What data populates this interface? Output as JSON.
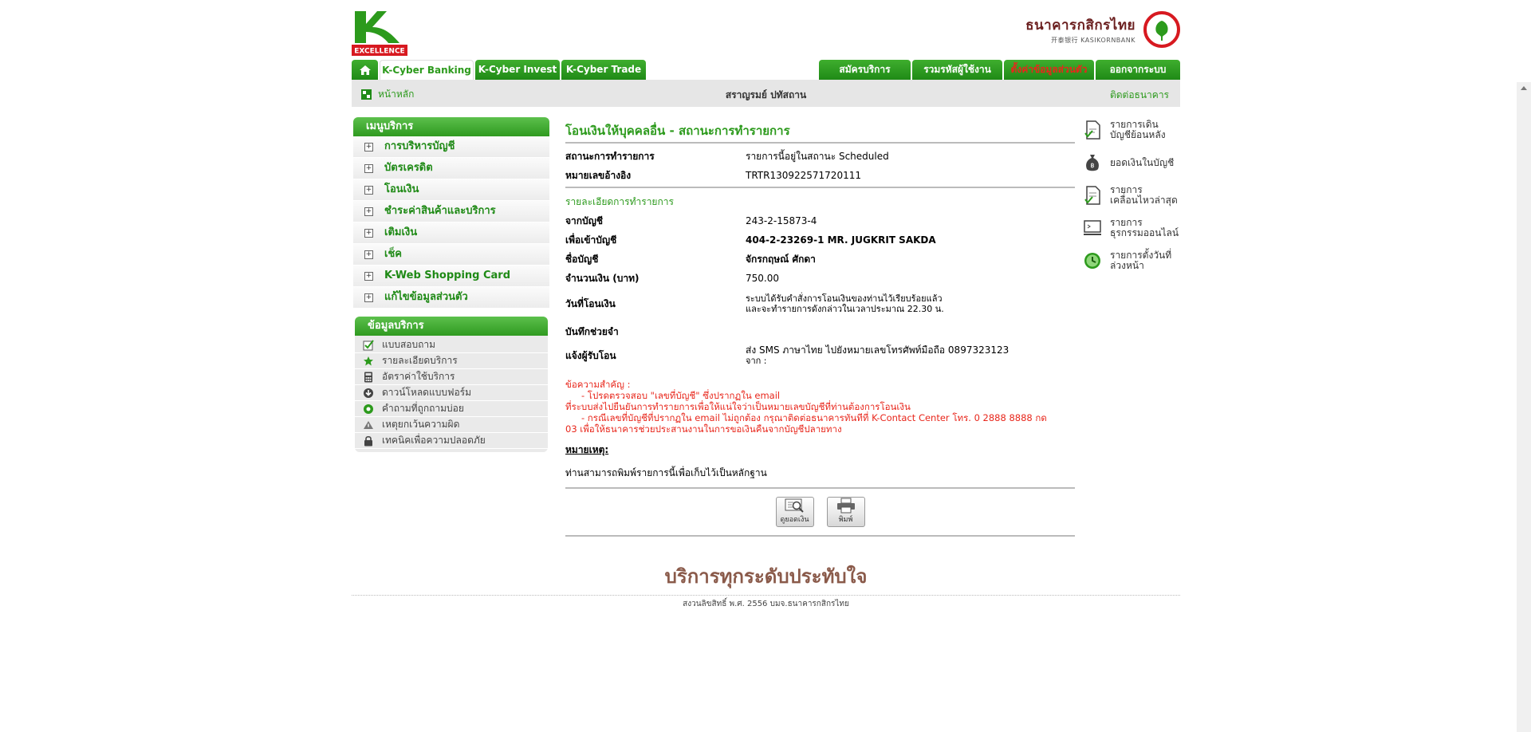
{
  "header": {
    "logo_text": "EXCELLENCE",
    "bank_name_thai": "ธนาคารกสิกรไทย",
    "bank_name_eng": "开泰银行 KASIKORNBANK"
  },
  "nav": {
    "left_tabs": [
      "K-Cyber Banking",
      "K-Cyber Invest",
      "K-Cyber Trade"
    ],
    "right_tabs": [
      "สมัครบริการ",
      "รวมรหัสผู้ใช้งาน",
      "ตั้งค่าข้อมูลส่วนตัว",
      "ออกจากระบบ"
    ]
  },
  "subbar": {
    "home": "หน้าหลัก",
    "username": "สราญรมย์ ปทัสถาน",
    "contact": "ติดต่อธนาคาร"
  },
  "menu": {
    "title": "เมนูบริการ",
    "items": [
      "การบริหารบัญชี",
      "บัตรเครดิต",
      "โอนเงิน",
      "ชำระค่าสินค้าและบริการ",
      "เติมเงิน",
      "เช็ค",
      "K-Web Shopping Card",
      "แก้ไขข้อมูลส่วนตัว"
    ]
  },
  "info": {
    "title": "ข้อมูลบริการ",
    "items": [
      "แบบสอบถาม",
      "รายละเอียดบริการ",
      "อัตราค่าใช้บริการ",
      "ดาวน์โหลดแบบฟอร์ม",
      "คำถามที่ถูกถามบ่อย",
      "เหตุยกเว้นความผิด",
      "เทคนิคเพื่อความปลอดภัย"
    ]
  },
  "main": {
    "title": "โอนเงินให้บุคคลอื่น - สถานะการทำรายการ",
    "status_label": "สถานะการทำรายการ",
    "status_value": "รายการนี้อยู่ในสถานะ Scheduled",
    "ref_label": "หมายเลขอ้างอิง",
    "ref_value": "TRTR130922571720111",
    "detail_title": "รายละเอียดการทำรายการ",
    "from_label": "จากบัญชี",
    "from_value": "243-2-15873-4",
    "to_label": "เพื่อเข้าบัญชี",
    "to_value": "404-2-23269-1 MR. JUGKRIT SAKDA",
    "name_label": "ชื่อบัญชี",
    "name_value": "จักรกฤษณ์ ศักดา",
    "amount_label": "จำนวนเงิน (บาท)",
    "amount_value": "750.00",
    "date_label": "วันที่โอนเงิน",
    "date_value_1": "ระบบได้รับคำสั่งการโอนเงินของท่านไว้เรียบร้อยแล้ว",
    "date_value_2": "และจะทำรายการดังกล่าวในเวลาประมาณ 22.30 น.",
    "memo_label": "บันทึกช่วยจำ",
    "notify_label": "แจ้งผู้รับโอน",
    "notify_value_1": "ส่ง SMS ภาษาไทย ไปยังหมายเลขโทรศัพท์มือถือ 0897323123",
    "notify_value_2": "จาก :",
    "warn_1": "ข้อความสำคัญ :",
    "warn_2": "- โปรดตรวจสอบ \"เลขที่บัญชี\" ซึ่งปรากฏใน email",
    "warn_3": "ที่ระบบส่งไปยืนยันการทำรายการเพื่อให้แน่ใจว่าเป็นหมายเลขบัญชีที่ท่านต้องการโอนเงิน",
    "warn_4": "- กรณีเลขที่บัญชีที่ปรากฏใน email ไม่ถูกต้อง กรุณาติดต่อธนาคารทันทีที่ K-Contact Center โทร. 0 2888 8888 กด",
    "warn_5": "03 เพื่อให้ธนาคารช่วยประสานงานในการขอเงินคืนจากบัญชีปลายทาง",
    "note_title": "หมายเหตุ:",
    "note_text": "ท่านสามารถพิมพ์รายการนี้เพื่อเก็บไว้เป็นหลักฐาน",
    "btn_balance": "ดูยอดเงิน",
    "btn_print": "พิมพ์"
  },
  "quick_links": [
    {
      "l1": "รายการเดิน",
      "l2": "บัญชีย้อนหลัง"
    },
    {
      "l1": "ยอดเงินในบัญชี",
      "l2": ""
    },
    {
      "l1": "รายการ",
      "l2": "เคลื่อนไหวล่าสุด"
    },
    {
      "l1": "รายการ",
      "l2": "ธุรกรรมออนไลน์"
    },
    {
      "l1": "รายการตั้งวันที่",
      "l2": "ล่วงหน้า"
    }
  ],
  "footer": {
    "slogan": "บริการทุกระดับประทับใจ",
    "copyright": "สงวนลิขสิทธิ์ พ.ศ. 2556 บมจ.ธนาคารกสิกรไทย"
  },
  "colors": {
    "brand_green": "#2c9a1c",
    "warning_red": "#e8261b"
  }
}
